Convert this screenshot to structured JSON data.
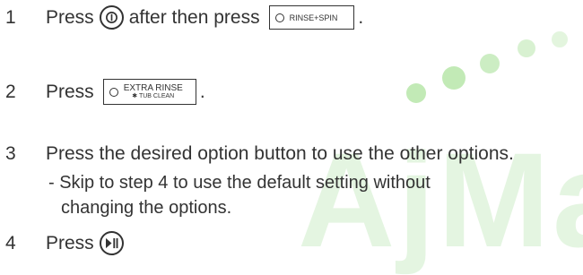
{
  "watermark": {
    "text": "AjMa"
  },
  "steps": [
    {
      "num": "1",
      "before": "Press",
      "middle": "after then press",
      "box": "RINSE+SPIN",
      "tail": "."
    },
    {
      "num": "2",
      "before": "Press",
      "box_line1": "EXTRA RINSE",
      "box_line2": "✱ TUB CLEAN",
      "tail": "."
    },
    {
      "num": "3",
      "text": "Press the desired option button to use the other options.",
      "sub_line1": "- Skip to step 4 to use the default setting without",
      "sub_line2": "changing the options."
    },
    {
      "num": "4",
      "before": "Press"
    }
  ],
  "icons": {
    "power": "power-icon",
    "start_pause": "play-pause-icon"
  }
}
